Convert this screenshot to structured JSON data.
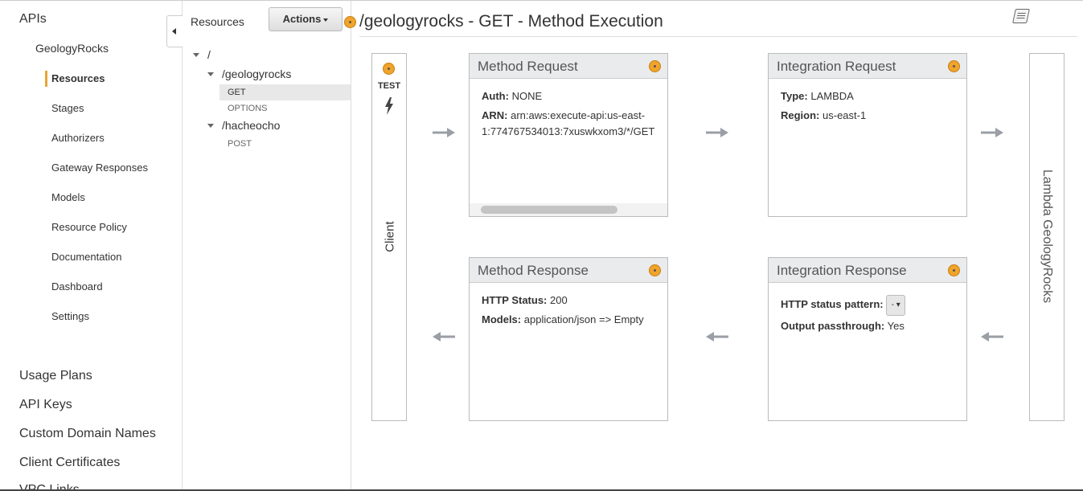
{
  "nav": {
    "apis": "APIs",
    "api_name": "GeologyRocks",
    "items": [
      "Resources",
      "Stages",
      "Authorizers",
      "Gateway Responses",
      "Models",
      "Resource Policy",
      "Documentation",
      "Dashboard",
      "Settings"
    ],
    "main": [
      "Usage Plans",
      "API Keys",
      "Custom Domain Names",
      "Client Certificates",
      "VPC Links"
    ]
  },
  "tree": {
    "title": "Resources",
    "actions_label": "Actions",
    "root": "/",
    "resources": [
      {
        "path": "/geologyrocks",
        "methods": [
          "GET",
          "OPTIONS"
        ]
      },
      {
        "path": "/hacheocho",
        "methods": [
          "POST"
        ]
      }
    ]
  },
  "main": {
    "title": "/geologyrocks - GET - Method Execution",
    "client": {
      "test_label": "TEST",
      "label": "Client"
    },
    "lambda_label": "Lambda GeologyRocks",
    "method_request": {
      "title": "Method Request",
      "auth_label": "Auth:",
      "auth_value": "NONE",
      "arn_label": "ARN:",
      "arn_line1": "arn:aws:execute-api:us-east-",
      "arn_line2": "1:774767534013:7xuswkxom3/*/GET"
    },
    "integration_request": {
      "title": "Integration Request",
      "type_label": "Type:",
      "type_value": "LAMBDA",
      "region_label": "Region:",
      "region_value": "us-east-1"
    },
    "method_response": {
      "title": "Method Response",
      "status_label": "HTTP Status:",
      "status_value": "200",
      "models_label": "Models:",
      "models_value": "application/json => Empty"
    },
    "integration_response": {
      "title": "Integration Response",
      "pattern_label": "HTTP status pattern:",
      "pattern_value": "-",
      "passthrough_label": "Output passthrough:",
      "passthrough_value": "Yes"
    }
  },
  "icons": {
    "collapse": "caret-left-icon",
    "gear": "gear-icon",
    "bolt": "lightning-bolt-icon",
    "book": "book-icon",
    "arrow": "arrow-icon"
  },
  "colors": {
    "accent": "#e7a535",
    "badge": "#f1a42b",
    "panel_header": "#eaebed",
    "arrow": "#9a9fa6"
  }
}
